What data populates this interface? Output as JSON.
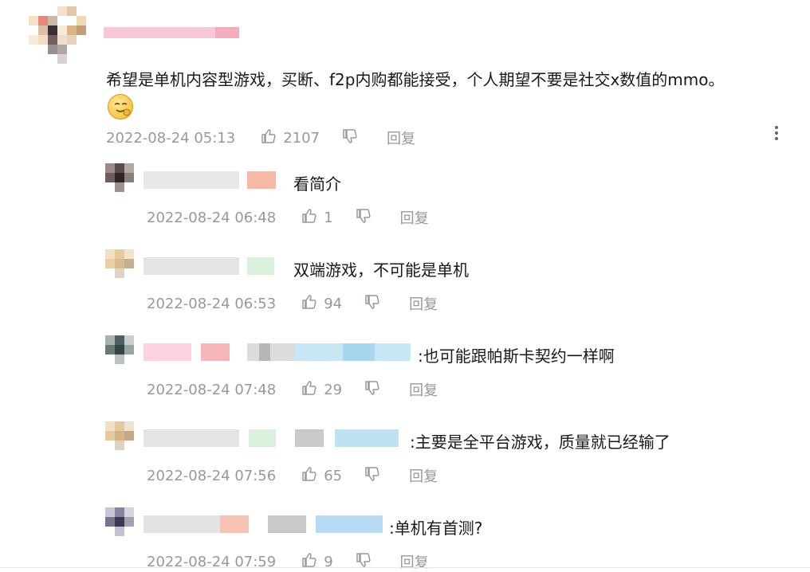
{
  "main_comment": {
    "text": "希望是单机内容型游戏，买断、f2p内购都能接受，个人期望不要是社交x数值的mmo。",
    "emoji_icon": "sly-smile-emoji-icon",
    "time": "2022-08-24 05:13",
    "likes": "2107",
    "reply_label": "回复"
  },
  "replies": [
    {
      "text": "看简介",
      "time": "2022-08-24 06:48",
      "likes": "1",
      "reply_label": "回复"
    },
    {
      "text": "双端游戏，不可能是单机",
      "time": "2022-08-24 06:53",
      "likes": "94",
      "reply_label": "回复"
    },
    {
      "text": ":也可能跟帕斯卡契约一样啊",
      "time": "2022-08-24 07:48",
      "likes": "29",
      "reply_label": "回复"
    },
    {
      "text": ":主要是全平台游戏，质量就已经输了",
      "time": "2022-08-24 07:56",
      "likes": "65",
      "reply_label": "回复"
    },
    {
      "text": ":单机有首测?",
      "time": "2022-08-24 07:59",
      "likes": "9",
      "reply_label": "回复"
    }
  ],
  "icons": {
    "like": "thumbs-up-icon",
    "dislike": "thumbs-down-icon",
    "more": "more-vertical-icon"
  },
  "colors": {
    "text": "#18191c",
    "meta": "#9499a0",
    "background": "#ffffff"
  }
}
